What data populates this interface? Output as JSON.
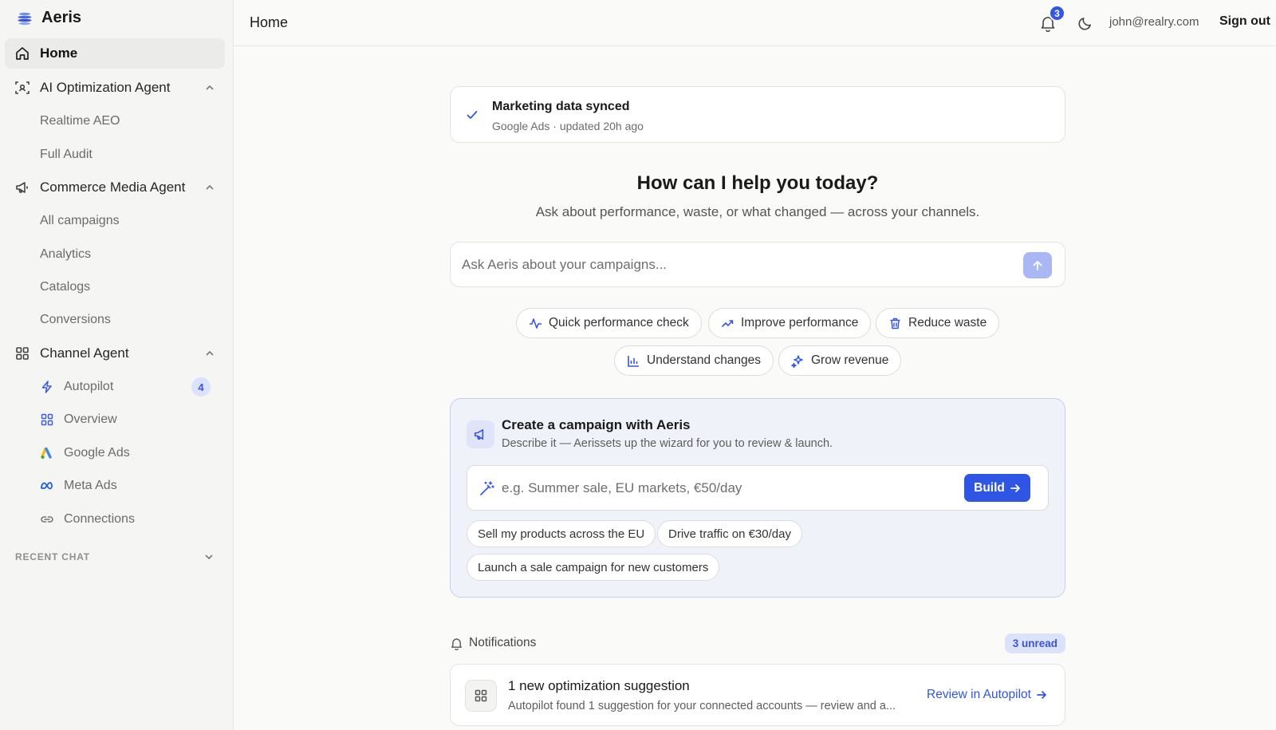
{
  "app": {
    "name": "Aeris"
  },
  "sidebar": {
    "home": "Home",
    "sections": [
      {
        "label": "AI Optimization Agent",
        "items": [
          "Realtime AEO",
          "Full Audit"
        ]
      },
      {
        "label": "Commerce Media Agent",
        "items": [
          "All campaigns",
          "Analytics",
          "Catalogs",
          "Conversions"
        ]
      },
      {
        "label": "Channel Agent",
        "items": [
          {
            "label": "Autopilot",
            "icon": "bolt-icon",
            "badge": "4"
          },
          {
            "label": "Overview",
            "icon": "grid-icon"
          },
          {
            "label": "Google Ads",
            "icon": "google-ads-icon"
          },
          {
            "label": "Meta Ads",
            "icon": "meta-icon"
          },
          {
            "label": "Connections",
            "icon": "link-icon"
          }
        ]
      }
    ],
    "recent_chat": "RECENT CHAT"
  },
  "header": {
    "title": "Home",
    "notification_count": "3",
    "user_email": "john@realry.com",
    "sign_out": "Sign out"
  },
  "sync": {
    "title": "Marketing data synced",
    "subtitle": "Google Ads · updated 20h ago"
  },
  "hero": {
    "title": "How can I help you today?",
    "subtitle": "Ask about performance, waste, or what changed — across your channels.",
    "placeholder": "Ask Aeris about your campaigns..."
  },
  "quick_actions": [
    {
      "label": "Quick performance check",
      "icon": "pulse-icon"
    },
    {
      "label": "Improve performance",
      "icon": "trending-up-icon"
    },
    {
      "label": "Reduce waste",
      "icon": "trash-icon"
    },
    {
      "label": "Understand changes",
      "icon": "bar-chart-icon"
    },
    {
      "label": "Grow revenue",
      "icon": "sparkles-icon"
    }
  ],
  "create": {
    "title": "Create a campaign with Aeris",
    "subtitle": "Describe it — Aerissets up the wizard for you to review & launch.",
    "placeholder": "e.g. Summer sale, EU markets, €50/day",
    "build": "Build",
    "suggestions": [
      "Sell my products across the EU",
      "Drive traffic on €30/day",
      "Launch a sale campaign for new customers"
    ]
  },
  "notifications": {
    "label": "Notifications",
    "unread": "3 unread",
    "items": [
      {
        "title": "1 new optimization suggestion",
        "description": "Autopilot found 1 suggestion for your connected accounts — review and a...",
        "action": "Review in Autopilot"
      }
    ]
  },
  "colors": {
    "accent": "#2f55e4",
    "badge_bg": "#dbe3fb",
    "sidebar_bg": "#f5f5f4"
  }
}
